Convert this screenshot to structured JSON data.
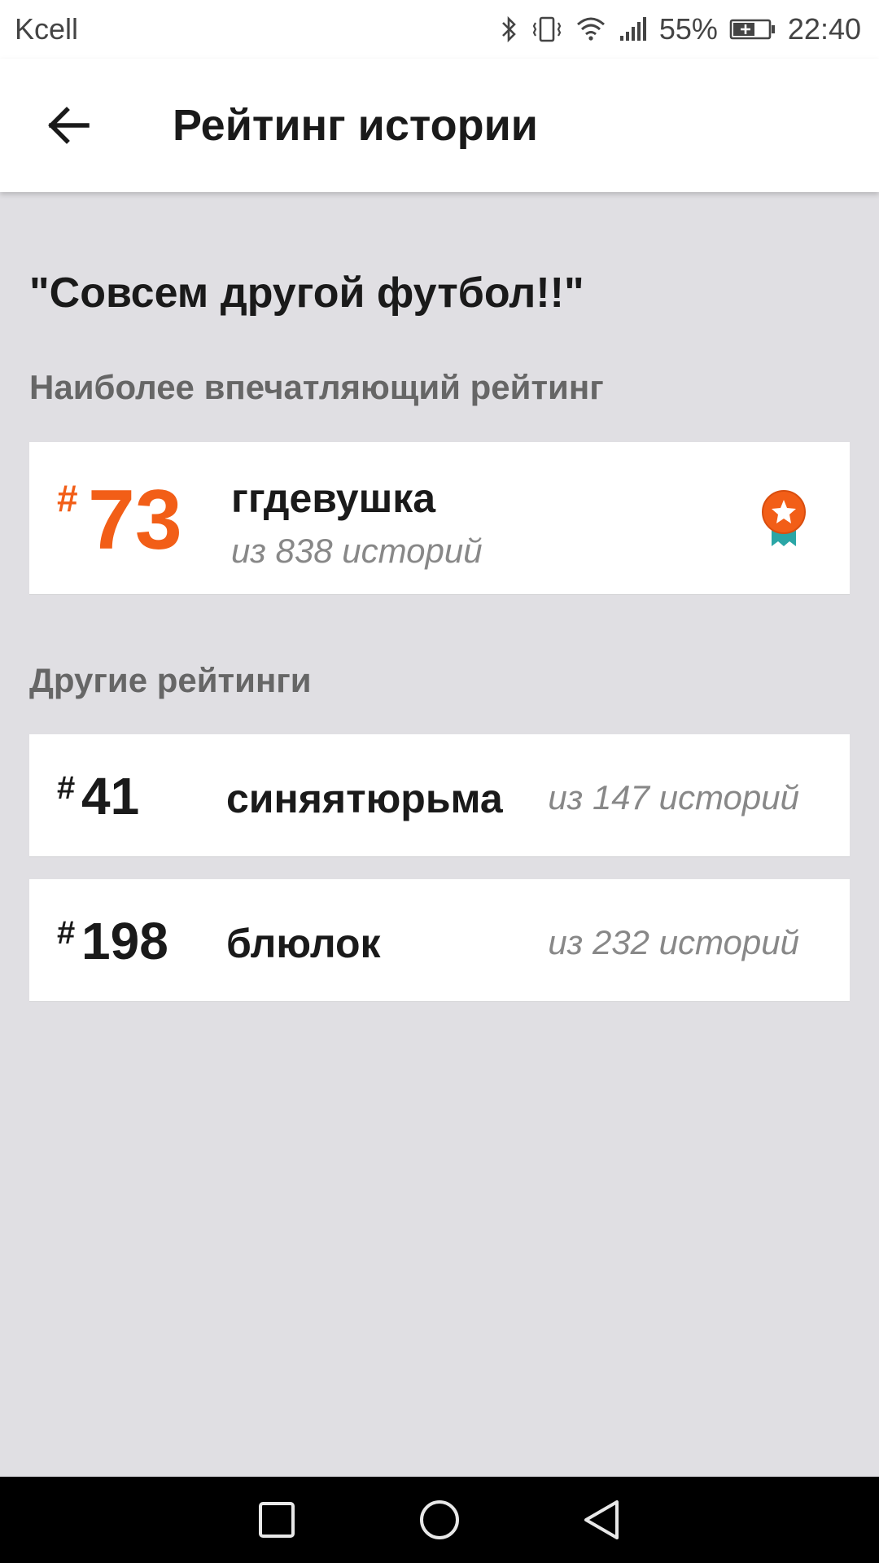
{
  "status_bar": {
    "carrier": "Kcell",
    "battery_percent": "55%",
    "time": "22:40"
  },
  "app_bar": {
    "title": "Рейтинг истории"
  },
  "story": {
    "title": "\"Совсем другой футбол!!\""
  },
  "sections": {
    "impressive_label": "Наиболее впечатляющий рейтинг",
    "other_label": "Другие рейтинги"
  },
  "main_rating": {
    "hash": "#",
    "rank": "73",
    "tag": "ггдевушка",
    "count": "из 838 историй"
  },
  "other_ratings": [
    {
      "hash": "#",
      "rank": "41",
      "tag": "синяятюрьма",
      "count": "из 147 историй"
    },
    {
      "hash": "#",
      "rank": "198",
      "tag": "блюлок",
      "count": "из 232 историй"
    }
  ],
  "colors": {
    "accent": "#f25e17",
    "award_teal": "#2aa6a6",
    "background": "#e0dfe3"
  },
  "icons": [
    "back-arrow-icon",
    "award-ribbon-icon",
    "bluetooth-icon",
    "vibrate-icon",
    "wifi-icon",
    "signal-icon",
    "battery-icon",
    "nav-recents-icon",
    "nav-home-icon",
    "nav-back-icon"
  ]
}
